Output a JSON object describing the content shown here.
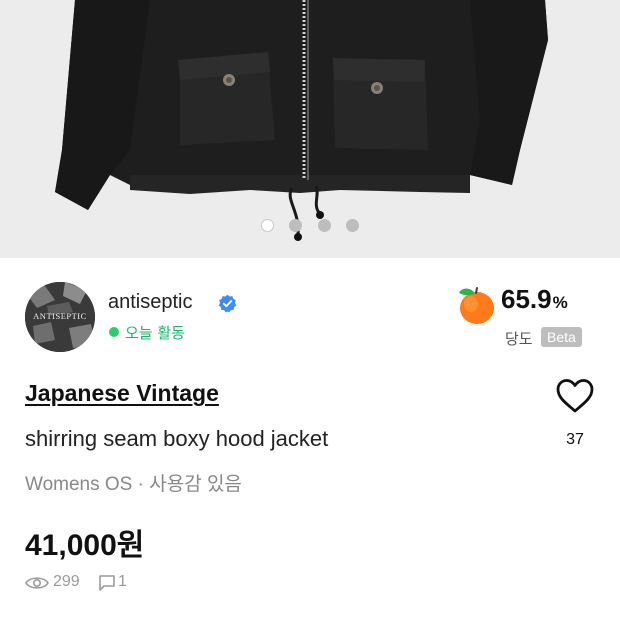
{
  "gallery": {
    "slide_count": 4,
    "active_index": 0
  },
  "seller": {
    "name": "antiseptic",
    "avatar_text": "ANTISEPTIC",
    "status": "오늘 활동",
    "verified": true
  },
  "sweetness": {
    "value": "65.9",
    "unit": "%",
    "label": "당도",
    "badge": "Beta"
  },
  "product": {
    "brand": "Japanese Vintage",
    "title": "shirring seam boxy hood jacket",
    "meta": "Womens OS · 사용감 있음",
    "price": "41,000원"
  },
  "stats": {
    "views": "299",
    "comments": "1"
  },
  "like": {
    "count": "37"
  },
  "colors": {
    "online_green": "#1fb46b",
    "verified_blue": "#3d8bfd",
    "muted_gray": "#888888",
    "beta_badge": "#bdbdbd"
  },
  "icons": [
    "verified-check-icon",
    "peach-icon",
    "heart-icon",
    "eye-icon",
    "chat-icon"
  ]
}
